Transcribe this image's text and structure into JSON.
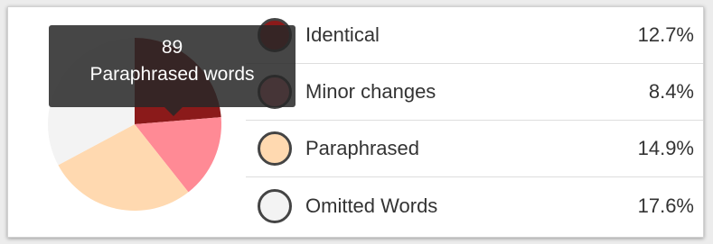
{
  "colors": {
    "identical": "#8b1a1a",
    "minor_changes": "#ff8a95",
    "paraphrased": "#ffd9b0",
    "omitted": "#f3f3f3",
    "swatch_border": "#444444"
  },
  "tooltip": {
    "value": "89",
    "label": "Paraphrased words"
  },
  "legend": [
    {
      "label": "Identical",
      "percent": "12.7%",
      "color_key": "identical"
    },
    {
      "label": "Minor changes",
      "percent": "8.4%",
      "color_key": "minor_changes"
    },
    {
      "label": "Paraphrased",
      "percent": "14.9%",
      "color_key": "paraphrased"
    },
    {
      "label": "Omitted Words",
      "percent": "17.6%",
      "color_key": "omitted"
    }
  ],
  "chart_data": {
    "type": "pie",
    "categories": [
      "Identical",
      "Minor changes",
      "Paraphrased",
      "Omitted Words"
    ],
    "values": [
      12.7,
      8.4,
      14.9,
      17.6
    ],
    "highlighted": "Paraphrased",
    "highlighted_count": 89
  }
}
